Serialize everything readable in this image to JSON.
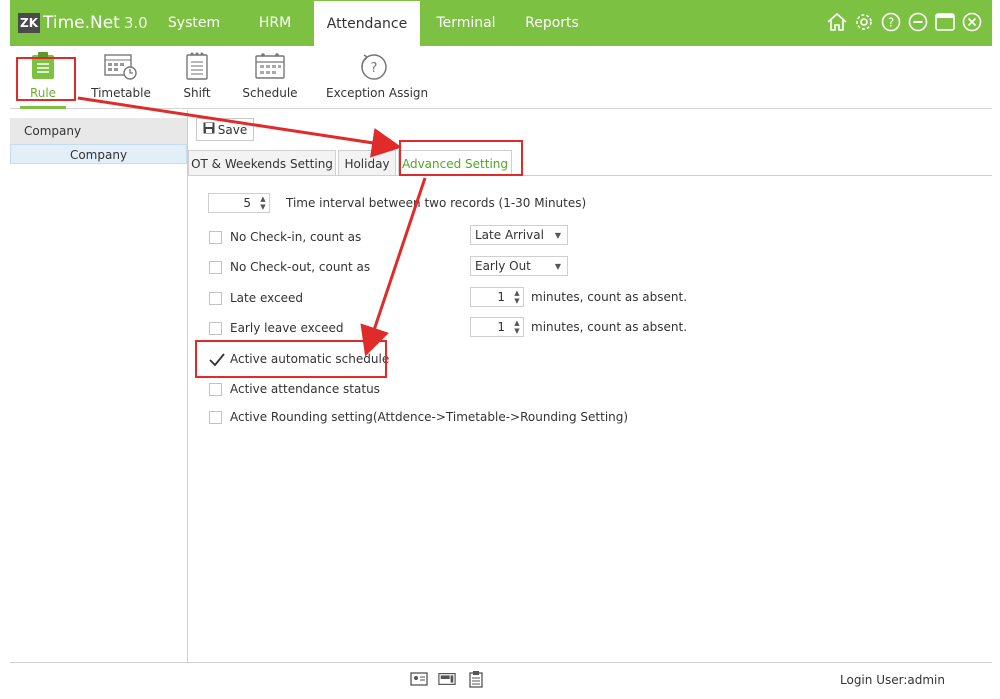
{
  "app": {
    "logo_badge": "ZK",
    "name": "Time.Net",
    "version": "3.0"
  },
  "menu": {
    "tabs": [
      {
        "label": "System"
      },
      {
        "label": "HRM"
      },
      {
        "label": "Attendance",
        "active": true
      },
      {
        "label": "Terminal"
      },
      {
        "label": "Reports"
      }
    ],
    "window_icons": [
      "home-icon",
      "gear-icon",
      "help-icon",
      "minimize-icon",
      "maximize-icon",
      "close-icon"
    ]
  },
  "toolbar": {
    "items": [
      {
        "label": "Rule",
        "icon": "rule-icon",
        "active": true
      },
      {
        "label": "Timetable",
        "icon": "timetable-icon"
      },
      {
        "label": "Shift",
        "icon": "shift-icon"
      },
      {
        "label": "Schedule",
        "icon": "schedule-icon"
      },
      {
        "label": "Exception Assign",
        "icon": "exception-assign-icon"
      }
    ]
  },
  "left_panel": {
    "header": "Company",
    "item": "Company"
  },
  "content": {
    "save_label": "Save",
    "sub_tabs": [
      {
        "label": "OT & Weekends Setting"
      },
      {
        "label": "Holiday"
      },
      {
        "label": "Advanced Setting",
        "active": true
      }
    ],
    "interval": {
      "value": "5",
      "label": "Time interval between two records (1-30 Minutes)"
    },
    "no_checkin": {
      "label": "No Check-in, count as",
      "checked": false,
      "selected": "Late Arrival"
    },
    "no_checkout": {
      "label": "No Check-out, count as",
      "checked": false,
      "selected": "Early Out"
    },
    "late_exceed": {
      "label": "Late exceed",
      "checked": false,
      "value": "1",
      "suffix": "minutes, count as absent."
    },
    "early_leave_exceed": {
      "label": "Early leave exceed",
      "checked": false,
      "value": "1",
      "suffix": "minutes, count as absent."
    },
    "active_auto_schedule": {
      "label": "Active automatic schedule",
      "checked": true
    },
    "active_attendance_status": {
      "label": "Active attendance status",
      "checked": false
    },
    "active_rounding": {
      "label": "Active Rounding setting(Attdence->Timetable->Rounding Setting)",
      "checked": false
    }
  },
  "status_bar": {
    "login_user": "Login User:admin"
  },
  "colors": {
    "accent": "#7cc142",
    "highlight": "#e02b2b",
    "active_tab_text": "#53a624"
  }
}
